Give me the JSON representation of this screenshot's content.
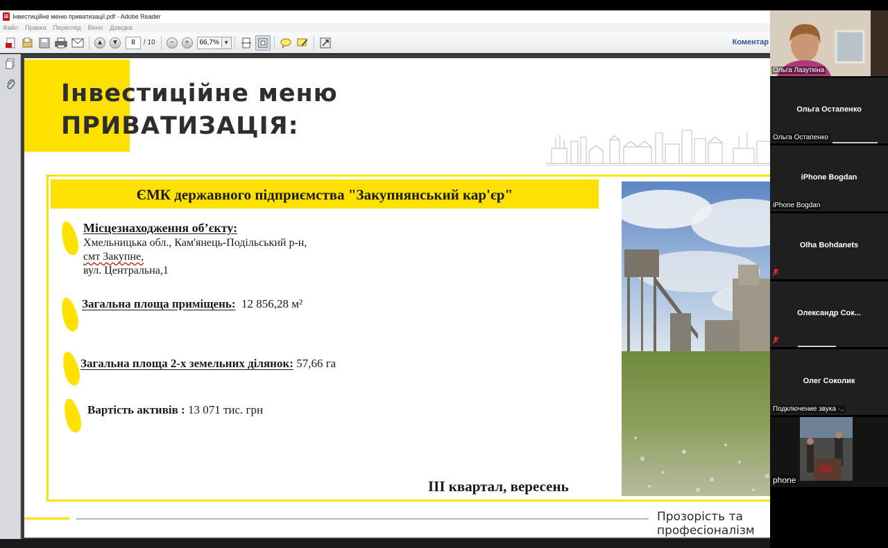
{
  "window": {
    "title": "Інвестиційне меню приватизації.pdf - Adobe Reader"
  },
  "menu": {
    "items": [
      "Файл",
      "Правка",
      "Перегляд",
      "Вікно",
      "Довідка"
    ]
  },
  "toolbar": {
    "page_current": "8",
    "page_total": "/ 10",
    "zoom": "66,7%",
    "comments_label": "Коментар"
  },
  "slide": {
    "title_line1": "Інвестиційне меню",
    "title_line2": "ПРИВАТИЗАЦІЯ:",
    "card_header": "ЄМК  державного підприємства \"Закупнянський кар'єр\"",
    "location_label": "Місцезнаходження об’єкту:",
    "location_line1": "Хмельницька обл., Кам'янець-Подільський р-н,",
    "location_line2": "смт Закупне,",
    "location_line3": "вул. Центральна,1",
    "area_label": "Загальна площа приміщень:",
    "area_value": "12 856,28 м²",
    "land_label": "Загальна площа 2-х земельних ділянок:",
    "land_value": "57,66 га",
    "assets_label": "Вартість активів :",
    "assets_value": "13 071 тис. грн",
    "quarter": "ІІІ квартал, вересень",
    "footer": "Прозорість та професіоналізм"
  },
  "participants": [
    {
      "name": "Ольга Лазуткіна",
      "video": true
    },
    {
      "center": "Ольга Остапенко",
      "name": "Ольга Остапенко"
    },
    {
      "center": "iPhone Bogdan",
      "name": "iPhone Bogdan"
    },
    {
      "center": "Olha Bohdanets",
      "muted": true
    },
    {
      "center": "Олександр  Сок...",
      "muted": true
    },
    {
      "center": "Олег Соколик",
      "name": "Подключение звука ·.."
    },
    {
      "name": "phone",
      "video": true
    }
  ],
  "colors": {
    "accent_yellow": "#ffe100",
    "reader_link": "#30578f",
    "tile_bg": "#1f1f1f",
    "mic_muted": "#e0322b"
  }
}
